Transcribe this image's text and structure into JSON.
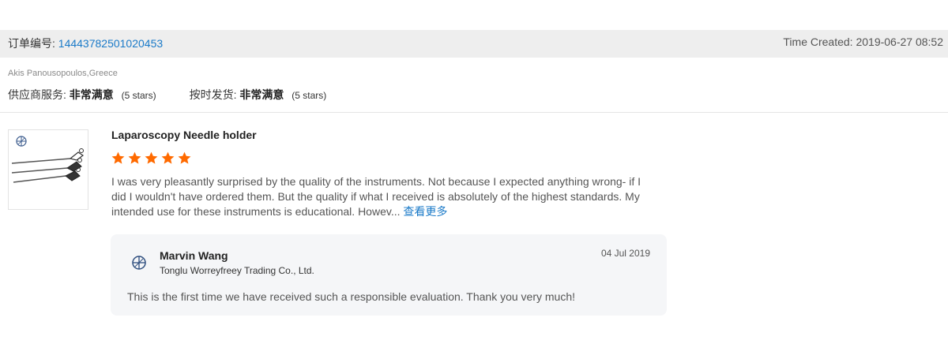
{
  "order": {
    "label": "订单编号:",
    "number": "14443782501020453",
    "time_created": "Time Created: 2019-06-27 08:52"
  },
  "buyer": {
    "name_location": "Akis Panousopoulos,Greece"
  },
  "ratings": [
    {
      "label": "供应商服务:",
      "value": "非常满意",
      "stars_text": "(5 stars)"
    },
    {
      "label": "按时发货:",
      "value": "非常满意",
      "stars_text": "(5 stars)"
    }
  ],
  "review": {
    "product_title": "Laparoscopy Needle holder",
    "rating": 5,
    "star_color": "#ff6a00",
    "text": "I was very pleasantly surprised by the quality of the instruments. Not because I expected anything wrong- if I did I wouldn't have ordered them. But the quality if what I received is absolutely of the highest standards. My intended use for these instruments is educational. Howev...",
    "see_more": "查看更多"
  },
  "reply": {
    "seller_name": "Marvin Wang",
    "company": "Tonglu Worreyfreey Trading Co., Ltd.",
    "date": "04 Jul 2019",
    "text": "This is the first time we have received such a responsible evaluation. Thank you very much!"
  },
  "colors": {
    "link": "#1a7ac8",
    "star": "#ff6a00",
    "order_bar": "#eeeeee",
    "reply_bg": "#f5f6f8"
  }
}
